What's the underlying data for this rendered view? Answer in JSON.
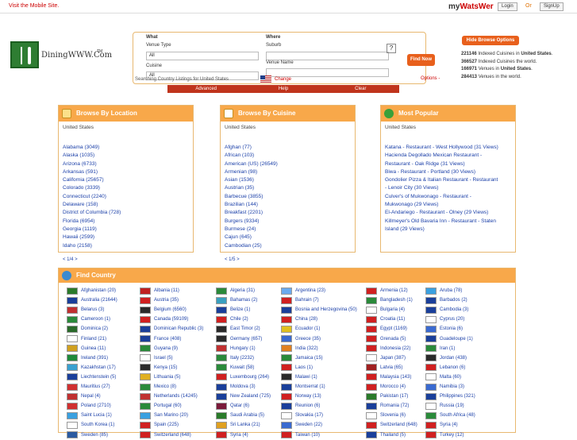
{
  "topbar": {
    "mobile_link": "Visit the Mobile Site.",
    "brand_my": "my",
    "brand_wats": "WatsWer",
    "login": "Login",
    "or": "Or",
    "signup": "SignUp"
  },
  "logo": {
    "text": "DiningWWW.Com",
    "tm": "TM"
  },
  "search": {
    "what_label": "What",
    "venue_type_label": "Venue Type",
    "venue_type_value": "All",
    "cuisine_label": "Cuisine",
    "cuisine_value": "All",
    "where_label": "Where",
    "suburb_label": "Suburb",
    "venue_name_label": "Venue Name",
    "help_q": "?",
    "find_now": "Find Now",
    "searching_text": "Searching Country Listings for United States",
    "change": "Change",
    "options": "Options -"
  },
  "nav": {
    "advanced": "Advanced",
    "help": "Help",
    "clear": "Clear"
  },
  "sidebar": {
    "hide_browse": "Hide Browse Options",
    "stats": [
      {
        "num": "221146",
        "text": " Indexed Cuisines in ",
        "bold": "United States",
        "end": "."
      },
      {
        "num": "366527",
        "text": " Indexed Cuisines the world.",
        "bold": "",
        "end": ""
      },
      {
        "num": "166971",
        "text": " Venues in ",
        "bold": "United States",
        "end": "."
      },
      {
        "num": "284413",
        "text": " Venues in the world.",
        "bold": "",
        "end": ""
      }
    ]
  },
  "browse_location": {
    "title": "Browse By Location",
    "sub": "United States",
    "items": [
      "Alabama (3049)",
      "Alaska (1035)",
      "Arizona (6733)",
      "Arkansas (591)",
      "California (25657)",
      "Colorado (3339)",
      "Connecticut (2240)",
      "Delaware (158)",
      "District of Columbia (728)",
      "Florida (6954)",
      "Georgia (1119)",
      "Hawaii (2599)",
      "Idaho (2158)"
    ],
    "pager": "< 1/4 >"
  },
  "browse_cuisine": {
    "title": "Browse By Cuisine",
    "sub": "United States",
    "items": [
      "Afghan (77)",
      "African (103)",
      "American (US) (26549)",
      "Armenian (98)",
      "Asian (1536)",
      "Austrian (35)",
      "Barbecue (3855)",
      "Brazilian (144)",
      "Breakfast (2201)",
      "Burgers (9334)",
      "Burmese (24)",
      "Cajun (645)",
      "Cambodian (25)"
    ],
    "pager": "< 1/5 >"
  },
  "popular": {
    "title": "Most Popular",
    "sub": "United States",
    "lines": [
      "Katana - Restaurant - West Hollywood (31 Views)",
      "Hacienda Degollado Mexican Restaurant -",
      "Restaurant - Oak Ridge (31 Views)",
      "Biwa - Restaurant - Portland (30 Views)",
      "Gondolier Pizza & Italian Restaurant - Restaurant",
      "- Lenoir City (30 Views)",
      "Culver's of Mukwonago - Restaurant -",
      "Mukwonago (29 Views)",
      "El-Andariego - Restaurant - Olney (29 Views)",
      "Killmeyer's Old Bavaria Inn - Restaurant - Staten",
      "Island (29 Views)"
    ]
  },
  "countries": {
    "title": "Find Country",
    "columns": [
      [
        "Afghanistan (20)",
        "Australia (21644)",
        "Belarus (3)",
        "Cameroon (1)",
        "Dominica (2)",
        "Finland (21)",
        "Guinea (11)",
        "Ireland (391)",
        "Kazakhstan (17)",
        "Liechtenstein (5)",
        "Mauritius (27)",
        "Nepal (4)",
        "Poland (2710)",
        "Saint Lucia (1)",
        "South Korea (1)",
        "Sweden (85)"
      ],
      [
        "Albania (11)",
        "Austria (35)",
        "Belgium (6560)",
        "Canada (59109)",
        "Dominican Republic (3)",
        "France (408)",
        "Guyana (9)",
        "Israel (5)",
        "Kenya (15)",
        "Lithuania (5)",
        "Mexico (8)",
        "Netherlands (14245)",
        "Portugal (60)",
        "San Marino (20)",
        "Spain (225)",
        "Switzerland (648)"
      ],
      [
        "Algeria (31)",
        "Bahamas (2)",
        "Belize (1)",
        "Chile (2)",
        "East Timor (2)",
        "Germany (657)",
        "Hungary (1)",
        "Italy (2232)",
        "Kuwait (58)",
        "Luxembourg (264)",
        "Moldova (3)",
        "New Zealand (725)",
        "Qatar (6)",
        "Saudi Arabia (5)",
        "Sri Lanka (21)",
        "Syria (4)"
      ],
      [
        "Argentina (23)",
        "Bahrain (7)",
        "Bosnia and Herzegovina (50)",
        "China (28)",
        "Ecuador (1)",
        "Greece (35)",
        "India (322)",
        "Jamaica (15)",
        "Laos (1)",
        "Malawi (1)",
        "Montserrat (1)",
        "Norway (13)",
        "Reunion (6)",
        "Slovakia (17)",
        "Sweden (22)",
        "Taiwan (10)"
      ],
      [
        "Armenia (12)",
        "Bangladesh (1)",
        "Bulgaria (4)",
        "Croatia (11)",
        "Egypt (1169)",
        "Grenada (5)",
        "Indonesia (22)",
        "Japan (387)",
        "Latvia (65)",
        "Malaysia (143)",
        "Morocco (4)",
        "Pakistan (17)",
        "Romania (72)",
        "Slovenia (6)",
        "Switzerland (648)",
        "Thailand (5)"
      ],
      [
        "Aruba (78)",
        "Barbados (2)",
        "Cambodia (3)",
        "Cyprus (20)",
        "Estonia (6)",
        "Guadeloupe (1)",
        "Iran (1)",
        "Jordan (438)",
        "Lebanon (6)",
        "Malta (60)",
        "Namibia (3)",
        "Philippines (321)",
        "Russia (19)",
        "South Africa (48)",
        "Syria (4)",
        "Turkey (12)"
      ]
    ],
    "flag_colors": [
      [
        "#2a7a2a",
        "#1a3f9a",
        "#c03030",
        "#2a8a3a",
        "#2a6a2a",
        "#fff",
        "#d0a020",
        "#1f8a3a",
        "#3aa0d0",
        "#1a3f9a",
        "#d03030",
        "#c03030",
        "#d03030",
        "#3aa0e0",
        "#fff",
        "#2a5aa0"
      ],
      [
        "#c02020",
        "#d02020",
        "#2a2a2a",
        "#d02020",
        "#1a3f9a",
        "#1a3f9a",
        "#2a8a3a",
        "#fff",
        "#2a2a2a",
        "#e0b020",
        "#2a8a3a",
        "#c03030",
        "#2a8a3a",
        "#3aa0e0",
        "#d02020",
        "#d02020"
      ],
      [
        "#2a8a3a",
        "#3aa0c0",
        "#1a3f9a",
        "#d02020",
        "#2a2a2a",
        "#2a2a2a",
        "#c03030",
        "#2a8a3a",
        "#2a8a3a",
        "#d02020",
        "#1a3f9a",
        "#1a3f9a",
        "#7a1a3a",
        "#2a7a2a",
        "#e0a020",
        "#d02020"
      ],
      [
        "#6aaaee",
        "#d02020",
        "#1a3f9a",
        "#d02020",
        "#e0c020",
        "#3a6ad0",
        "#e08020",
        "#2a8a3a",
        "#d02020",
        "#2a2a2a",
        "#1a3f9a",
        "#d02020",
        "#1a3f9a",
        "#fff",
        "#3a6ad0",
        "#d02020"
      ],
      [
        "#d02020",
        "#2a8a3a",
        "#fff",
        "#d02020",
        "#d02020",
        "#d02020",
        "#d02020",
        "#fff",
        "#a02020",
        "#d02020",
        "#d02020",
        "#2a7a2a",
        "#1a3f9a",
        "#fff",
        "#d02020",
        "#1a3f9a"
      ],
      [
        "#3aa0e0",
        "#1a3f9a",
        "#1a3f9a",
        "#fff",
        "#3a6ad0",
        "#1a3f9a",
        "#2a8a3a",
        "#2a2a2a",
        "#d02020",
        "#fff",
        "#3a6ad0",
        "#1a3f9a",
        "#fff",
        "#2a8a3a",
        "#d02020",
        "#d02020"
      ]
    ]
  }
}
